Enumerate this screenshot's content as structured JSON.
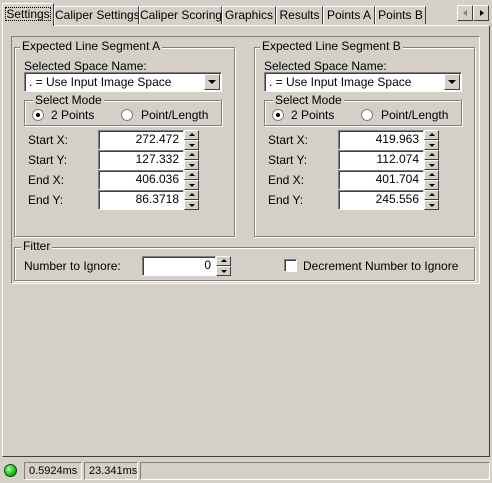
{
  "tabs": [
    {
      "label": "Settings"
    },
    {
      "label": "Caliper Settings"
    },
    {
      "label": "Caliper Scoring"
    },
    {
      "label": "Graphics"
    },
    {
      "label": "Results"
    },
    {
      "label": "Points A"
    },
    {
      "label": "Points B"
    }
  ],
  "segA": {
    "title": "Expected Line Segment A",
    "space_label": "Selected Space Name:",
    "space_value": ". = Use Input Image Space",
    "mode_title": "Select Mode",
    "mode_2pts": "2 Points",
    "mode_pl": "Point/Length",
    "start_x_label": "Start X:",
    "start_y_label": "Start Y:",
    "end_x_label": "End X:",
    "end_y_label": "End Y:",
    "start_x": "272.472",
    "start_y": "127.332",
    "end_x": "406.036",
    "end_y": "86.3718"
  },
  "segB": {
    "title": "Expected Line Segment B",
    "space_label": "Selected Space Name:",
    "space_value": ". = Use Input Image Space",
    "mode_title": "Select Mode",
    "mode_2pts": "2 Points",
    "mode_pl": "Point/Length",
    "start_x_label": "Start X:",
    "start_y_label": "Start Y:",
    "end_x_label": "End X:",
    "end_y_label": "End Y:",
    "start_x": "419.963",
    "start_y": "112.074",
    "end_x": "401.704",
    "end_y": "245.556"
  },
  "fitter": {
    "title": "Fitter",
    "num_ignore_label": "Number to Ignore:",
    "num_ignore_value": "0",
    "decrement_label": "Decrement Number to Ignore"
  },
  "status": {
    "time1": "0.5924ms",
    "time2": "23.341ms",
    "led_color": "#22c322"
  }
}
